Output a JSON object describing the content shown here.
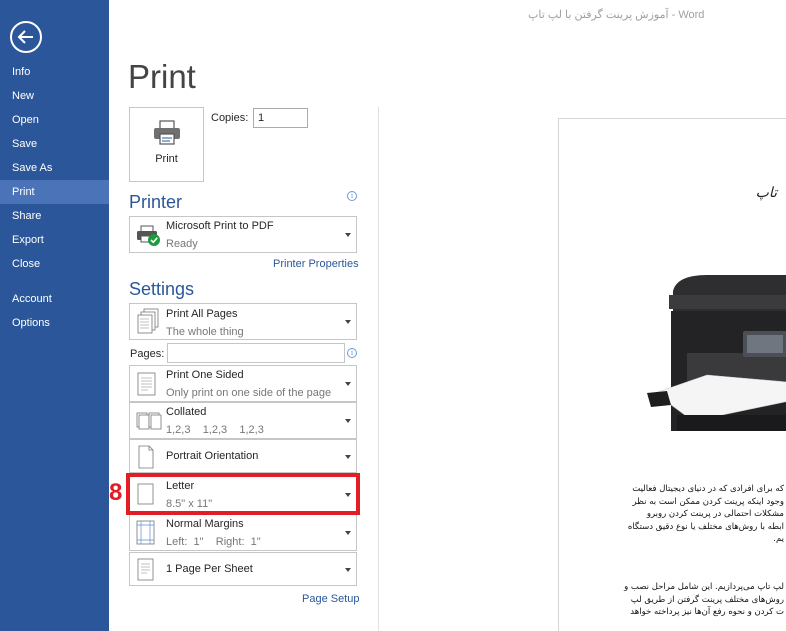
{
  "window": {
    "title": "آموزش پرینت گرفتن با لپ تاپ - Word"
  },
  "nav": {
    "items": [
      {
        "label": "Info"
      },
      {
        "label": "New"
      },
      {
        "label": "Open"
      },
      {
        "label": "Save"
      },
      {
        "label": "Save As"
      },
      {
        "label": "Print"
      },
      {
        "label": "Share"
      },
      {
        "label": "Export"
      },
      {
        "label": "Close"
      },
      {
        "label": "Account"
      },
      {
        "label": "Options"
      }
    ],
    "active": "Print"
  },
  "page": {
    "title": "Print"
  },
  "print_button": {
    "label": "Print"
  },
  "copies": {
    "label": "Copies:",
    "value": "1"
  },
  "printer": {
    "heading": "Printer",
    "name": "Microsoft Print to PDF",
    "status": "Ready",
    "properties_link": "Printer Properties"
  },
  "settings": {
    "heading": "Settings",
    "print_pages": {
      "title": "Print All Pages",
      "subtitle": "The whole thing"
    },
    "pages": {
      "label": "Pages:",
      "value": ""
    },
    "sides": {
      "title": "Print One Sided",
      "subtitle": "Only print on one side of the page"
    },
    "collation": {
      "title": "Collated",
      "subtitle": "1,2,3    1,2,3    1,2,3"
    },
    "orientation": {
      "title": "Portrait Orientation"
    },
    "paper_size": {
      "title": "Letter",
      "subtitle": "8.5\" x 11\""
    },
    "margins": {
      "title": "Normal Margins",
      "subtitle": "Left:  1\"    Right:  1\""
    },
    "pages_per_sheet": {
      "title": "1 Page Per Sheet"
    },
    "page_setup_link": "Page Setup"
  },
  "annotation": {
    "step": "8",
    "color": "#e21d25"
  },
  "preview": {
    "heading": "تاپ",
    "paragraph1": "که برای افرادی که در دنیای دیجیتال فعالیت\nوجود اینکه پرینت کردن ممکن است به نظر\nمشکلات احتمالی در پرینت کردن روبرو\nابطه با روش‌های مختلف یا نوع دقیق دستگاه\nیم.",
    "paragraph2": "لپ تاپ می‌پردازیم. این شامل مراحل نصب و\nروش‌های مختلف پرینت گرفتن از طریق لپ\nت کردن و نحوه رفع آن‌ها نیز پرداخته خواهد"
  },
  "colors": {
    "nav_bg": "#2b579a",
    "nav_active": "#4a74b7",
    "accent": "#2b579a"
  }
}
